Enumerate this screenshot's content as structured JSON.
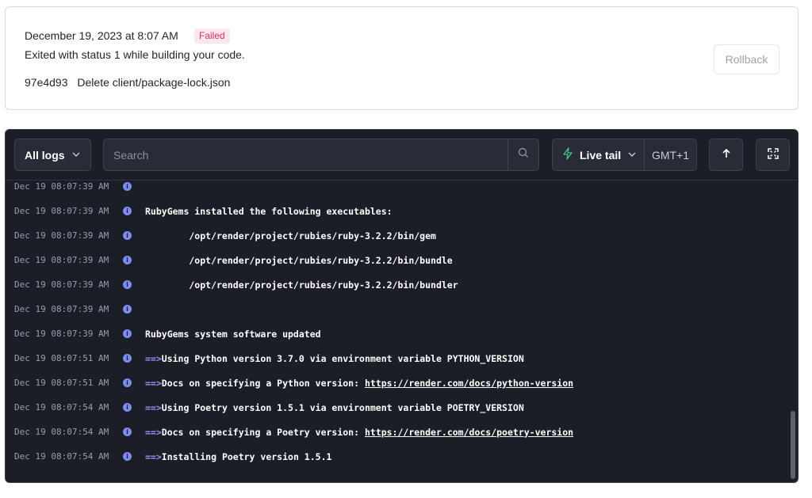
{
  "deploy": {
    "date": "December 19, 2023 at 8:07 AM",
    "status": "Failed",
    "message": "Exited with status 1 while building your code.",
    "commit_hash": "97e4d93",
    "commit_message": "Delete client/package-lock.json",
    "rollback_label": "Rollback"
  },
  "toolbar": {
    "all_logs_label": "All logs",
    "search_placeholder": "Search",
    "live_tail_label": "Live tail",
    "timezone_label": "GMT+1"
  },
  "logs": [
    {
      "ts": "Dec 19 08:07:39 AM",
      "prefix": "",
      "text": "",
      "link": ""
    },
    {
      "ts": "Dec 19 08:07:39 AM",
      "prefix": "",
      "text": "RubyGems installed the following executables:",
      "link": ""
    },
    {
      "ts": "Dec 19 08:07:39 AM",
      "prefix": "",
      "text": "        /opt/render/project/rubies/ruby-3.2.2/bin/gem",
      "link": ""
    },
    {
      "ts": "Dec 19 08:07:39 AM",
      "prefix": "",
      "text": "        /opt/render/project/rubies/ruby-3.2.2/bin/bundle",
      "link": ""
    },
    {
      "ts": "Dec 19 08:07:39 AM",
      "prefix": "",
      "text": "        /opt/render/project/rubies/ruby-3.2.2/bin/bundler",
      "link": ""
    },
    {
      "ts": "Dec 19 08:07:39 AM",
      "prefix": "",
      "text": "",
      "link": ""
    },
    {
      "ts": "Dec 19 08:07:39 AM",
      "prefix": "",
      "text": "RubyGems system software updated",
      "link": ""
    },
    {
      "ts": "Dec 19 08:07:51 AM",
      "prefix": "==>",
      "text": "Using Python version 3.7.0 via environment variable PYTHON_VERSION",
      "link": ""
    },
    {
      "ts": "Dec 19 08:07:51 AM",
      "prefix": "==>",
      "text": "Docs on specifying a Python version: ",
      "link": "https://render.com/docs/python-version"
    },
    {
      "ts": "Dec 19 08:07:54 AM",
      "prefix": "==>",
      "text": "Using Poetry version 1.5.1 via environment variable POETRY_VERSION",
      "link": ""
    },
    {
      "ts": "Dec 19 08:07:54 AM",
      "prefix": "==>",
      "text": "Docs on specifying a Poetry version: ",
      "link": "https://render.com/docs/poetry-version"
    },
    {
      "ts": "Dec 19 08:07:54 AM",
      "prefix": "==>",
      "text": "Installing Poetry version 1.5.1",
      "link": ""
    }
  ],
  "colors": {
    "failed_badge_bg": "#fde7ec",
    "failed_badge_text": "#d1335a",
    "log_bg": "#1c1e27",
    "info_icon": "#7f8cf2",
    "live_tail_icon": "#3ec98a"
  },
  "icons": {
    "all_logs": "chevron-down-icon",
    "search": "search-icon",
    "live_tail": "lightning-icon",
    "scroll_top": "arrow-up-icon",
    "fullscreen": "expand-icon",
    "log_level": "info-icon"
  }
}
